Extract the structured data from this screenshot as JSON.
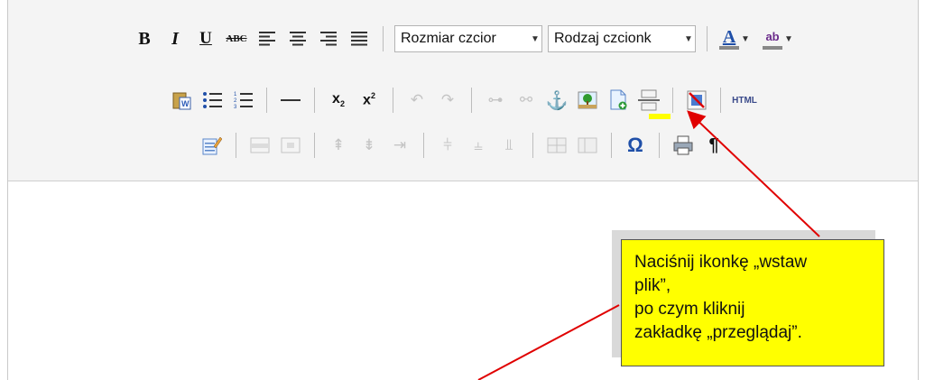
{
  "toolbar": {
    "row1": {
      "font_size_select": "Rozmiar czcior",
      "font_family_select": "Rodzaj czcionk",
      "bold_glyph": "B",
      "italic_glyph": "I",
      "underline_glyph": "U",
      "strike_glyph": "ABC",
      "text_color_glyph": "A",
      "highlight_glyph": "ab"
    },
    "row2": {
      "html_label": "HTML"
    }
  },
  "callout": {
    "line1": "Naciśnij ikonkę „wstaw",
    "line2": "plik”,",
    "line3": "po czym kliknij",
    "line4": "zakładkę „przeglądaj”."
  },
  "colors": {
    "callout_bg": "#ffff00",
    "arrow": "#e00000",
    "toolbar_bg": "#f4f4f4"
  }
}
